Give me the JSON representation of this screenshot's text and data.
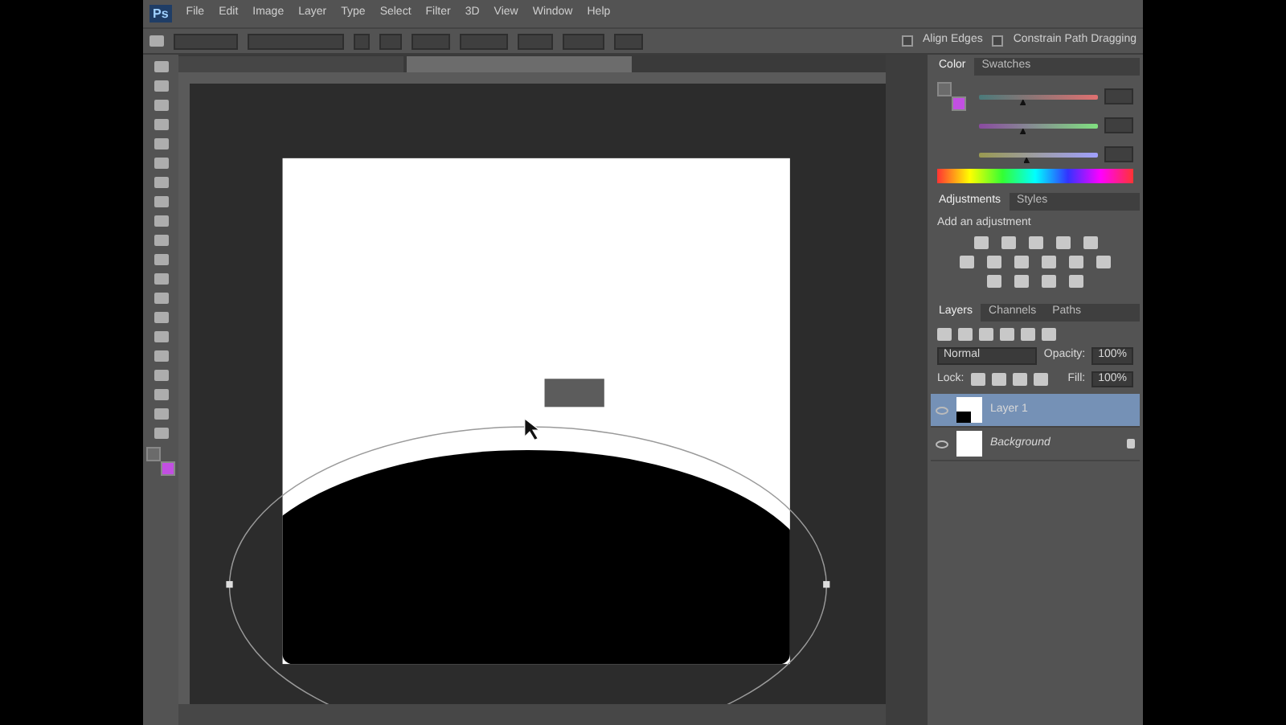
{
  "menu_bar": {
    "logo": "Ps",
    "items": [
      "File",
      "Edit",
      "Image",
      "Layer",
      "Type",
      "Select",
      "Filter",
      "3D",
      "View",
      "Window",
      "Help"
    ]
  },
  "options_bar": {
    "checkboxes": [
      {
        "label": "Align Edges",
        "checked": false
      },
      {
        "label": "Constrain Path Dragging",
        "checked": false
      }
    ]
  },
  "document_tabs": [
    {
      "selected": false
    },
    {
      "selected": true
    }
  ],
  "swatches": [
    {
      "kind": "foreground",
      "color": "#6b6b6b"
    },
    {
      "kind": "background",
      "color": "#c24fe2"
    }
  ],
  "color_panel": {
    "tabs": [
      {
        "label": "Color",
        "selected": true
      },
      {
        "label": "Swatches",
        "selected": false
      }
    ],
    "sliders": [
      {
        "level": 0.37
      },
      {
        "level": 0.37
      },
      {
        "level": 0.4
      }
    ]
  },
  "adjustments_panel": {
    "tabs": [
      {
        "label": "Adjustments",
        "selected": true
      },
      {
        "label": "Styles",
        "selected": false
      }
    ],
    "hint": "Add an adjustment"
  },
  "layers_panel": {
    "tabs": [
      {
        "label": "Layers",
        "selected": true
      },
      {
        "label": "Channels",
        "selected": false
      },
      {
        "label": "Paths",
        "selected": false
      }
    ],
    "blend_mode": "Normal",
    "opacity_label": "Opacity:",
    "opacity": "100%",
    "lock_label": "Lock:",
    "fill_label": "Fill:",
    "fill": "100%",
    "layers": [
      {
        "name": "Layer 1",
        "kind": "shape",
        "visible": true,
        "selected": true,
        "locked": false
      },
      {
        "name": "Background",
        "kind": "background",
        "visible": true,
        "selected": false,
        "locked": true
      }
    ]
  }
}
